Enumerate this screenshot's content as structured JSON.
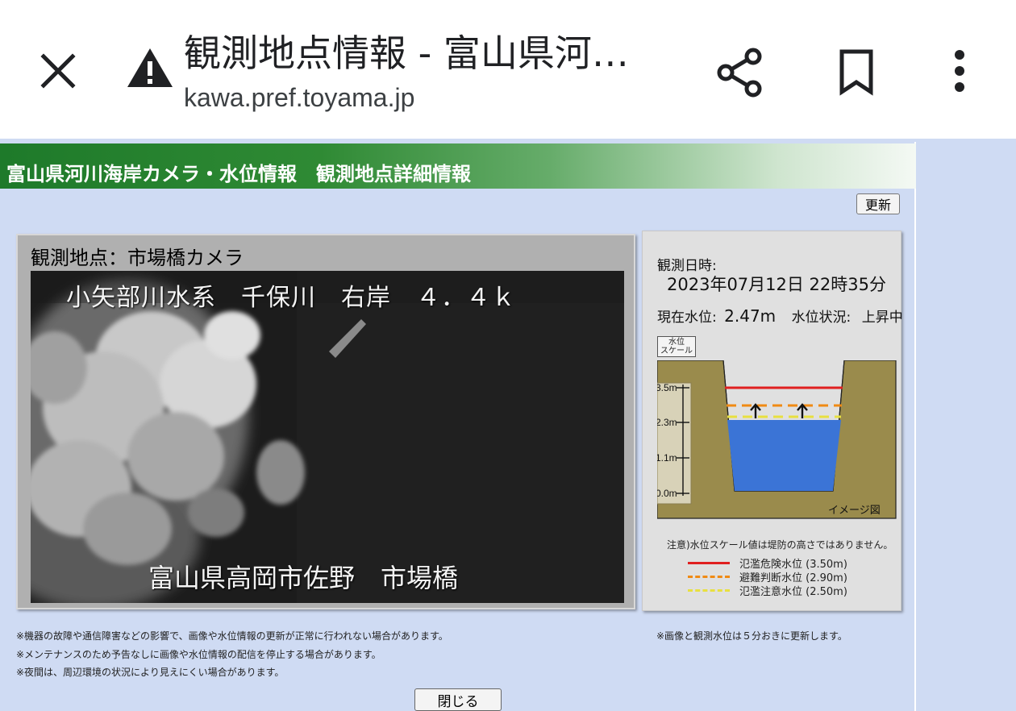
{
  "browser": {
    "title": "観測地点情報 - 富山県河…",
    "url": "kawa.pref.toyama.jp",
    "icons": {
      "close": "close-icon",
      "warning": "warning-triangle-icon",
      "share": "share-icon",
      "bookmark": "bookmark-icon",
      "more": "more-vert-icon"
    }
  },
  "page": {
    "header_title": "富山県河川海岸カメラ・水位情報　観測地点詳細情報",
    "refresh_label": "更新",
    "camera": {
      "label": "観測地点：市場橋カメラ",
      "overlay_top": "小矢部川水系　千保川　右岸　４．４ｋ",
      "overlay_bottom": "富山県高岡市佐野　市場橋"
    },
    "info": {
      "obs_label": "観測日時:",
      "obs_time": "2023年07月12日 22時35分",
      "level_label": "現在水位:",
      "level_value": "2.47m",
      "status_label": "水位状況:",
      "status_value": "上昇中",
      "scale_button": "水位スケール",
      "scale_line1": "水位",
      "scale_line2": "スケール",
      "diagram": {
        "ticks": [
          "3.5m",
          "2.3m",
          "1.1m",
          "0.0m"
        ],
        "image_label": "イメージ図",
        "water_level_m": 2.47,
        "colors": {
          "bank": "#9a8b4c",
          "water": "#3b74d6",
          "danger": "#e02020",
          "evac": "#f08a14",
          "caution": "#e8e040"
        }
      },
      "caution_note": "注意)水位スケール値は堤防の高さではありません。",
      "legend": [
        {
          "label": "氾濫危険水位 (3.50m)",
          "color": "#e02020",
          "style": "solid"
        },
        {
          "label": "避難判断水位 (2.90m)",
          "color": "#f08a14",
          "style": "dashed"
        },
        {
          "label": "氾濫注意水位 (2.50m)",
          "color": "#e8e040",
          "style": "dashed"
        }
      ]
    },
    "notes": [
      "※機器の故障や通信障害などの影響で、画像や水位情報の更新が正常に行われない場合があります。",
      "※メンテナンスのため予告なしに画像や水位情報の配信を停止する場合があります。",
      "※夜間は、周辺環境の状況により見えにくい場合があります。"
    ],
    "update_note": "※画像と観測水位は５分おきに更新します。",
    "close_label": "閉じる"
  }
}
